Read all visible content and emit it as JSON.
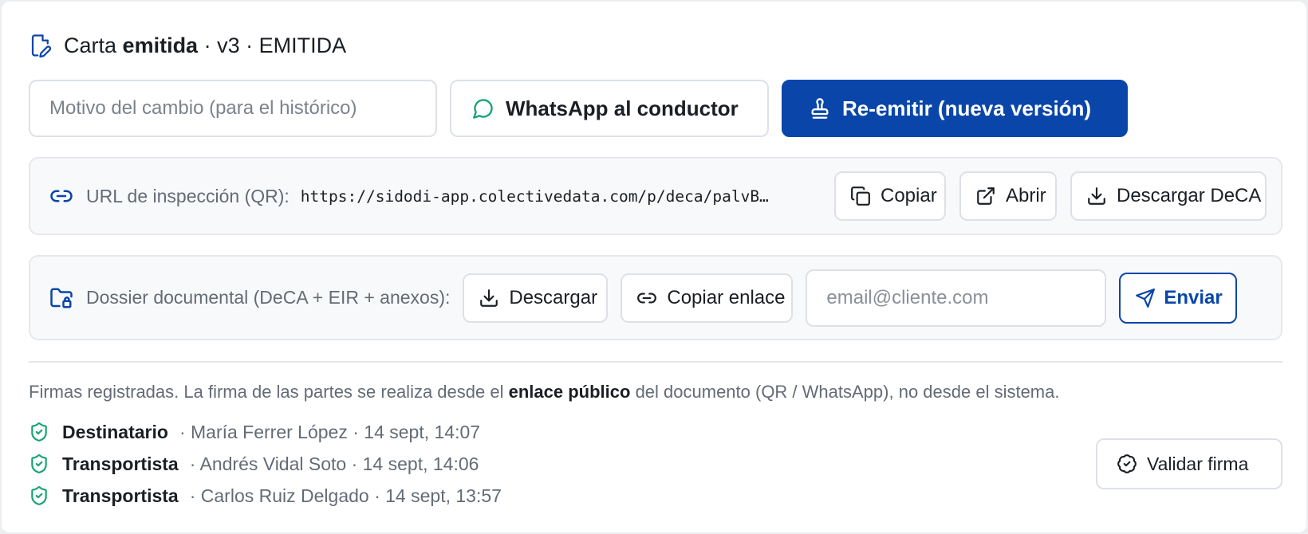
{
  "header": {
    "title_prefix": "Carta",
    "title_strong": "emitida",
    "title_suffix": "· v3 · EMITIDA"
  },
  "actions": {
    "reason_placeholder": "Motivo del cambio (para el histórico)",
    "whatsapp_label": "WhatsApp al conductor",
    "reemit_label": "Re-emitir (nueva versión)"
  },
  "inspection": {
    "label": "URL de inspección (QR):",
    "url": "https://sidodi-app.colectivedata.com/p/deca/palvB…",
    "copy_label": "Copiar",
    "open_label": "Abrir",
    "download_label": "Descargar DeCA"
  },
  "dossier": {
    "label": "Dossier documental (DeCA + EIR + anexos):",
    "download_label": "Descargar",
    "copy_link_label": "Copiar enlace",
    "email_placeholder": "email@cliente.com",
    "send_label": "Enviar"
  },
  "signatures": {
    "info_prefix": "Firmas registradas. La firma de las partes se realiza desde el",
    "info_link": "enlace público",
    "info_suffix": "del documento (QR / WhatsApp), no desde el sistema.",
    "items": [
      {
        "role": "Destinatario",
        "meta": "· María Ferrer López · 14 sept, 14:07"
      },
      {
        "role": "Transportista",
        "meta": "· Andrés Vidal Soto · 14 sept, 14:06"
      },
      {
        "role": "Transportista",
        "meta": "· Carlos Ruiz Delgado · 14 sept, 13:57"
      }
    ],
    "validate_label": "Validar firma"
  },
  "colors": {
    "primary": "#0a46a9",
    "whatsapp": "#17a373",
    "verified": "#17a373"
  },
  "icons": {
    "header": "document-edit-icon",
    "whatsapp": "message-circle-icon",
    "reemit": "stamp-icon",
    "url": "link-icon",
    "copy": "copy-icon",
    "open": "external-link-icon",
    "download": "download-icon",
    "dossier": "folder-lock-icon",
    "send": "send-icon",
    "verified": "shield-check-icon",
    "validate": "badge-check-icon"
  }
}
